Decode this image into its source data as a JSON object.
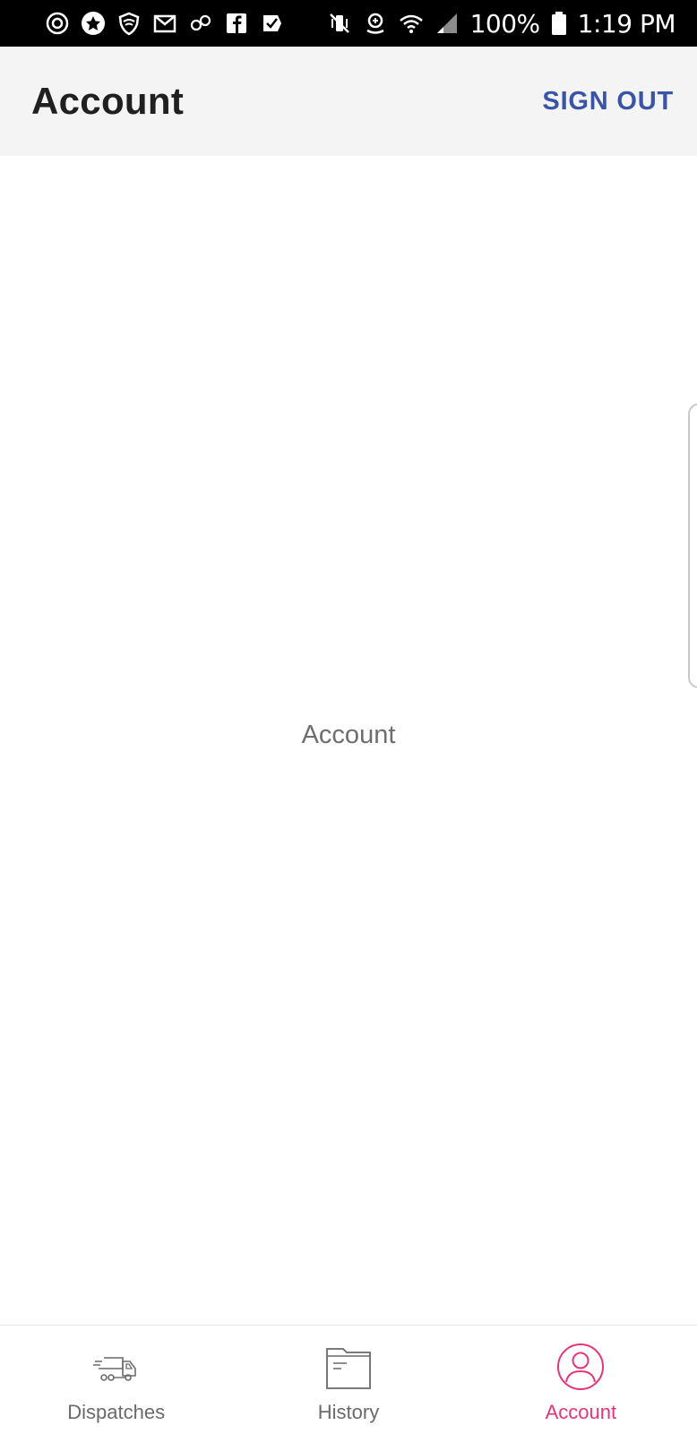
{
  "status_bar": {
    "battery": "100%",
    "time": "1:19 PM",
    "left_icons": [
      "sync-icon",
      "star-icon",
      "shield-icon",
      "gmail-icon",
      "link-icon",
      "facebook-icon",
      "task-check-icon"
    ],
    "right_icons": [
      "vibrate-mute-icon",
      "location-icon",
      "wifi-icon",
      "signal-icon",
      "battery-icon"
    ]
  },
  "app_bar": {
    "title": "Account",
    "action_label": "SIGN OUT",
    "action_color": "#3a55a8"
  },
  "main": {
    "center_text": "Account"
  },
  "bottom_nav": {
    "active_color": "#e5357a",
    "items": [
      {
        "label": "Dispatches",
        "icon": "truck-icon",
        "active": false
      },
      {
        "label": "History",
        "icon": "folder-icon",
        "active": false
      },
      {
        "label": "Account",
        "icon": "user-circle-icon",
        "active": true
      }
    ]
  }
}
